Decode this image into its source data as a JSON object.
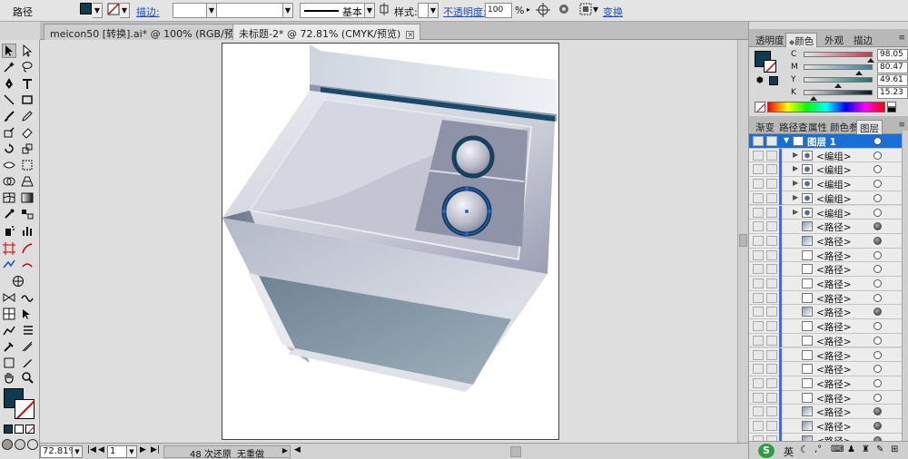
{
  "control_bar": {
    "mode_label": "路径",
    "stroke_label": "描边:",
    "stroke_style": "基本",
    "style_label": "样式:",
    "opacity_label": "不透明度:",
    "opacity_value": "100",
    "opacity_unit": "%",
    "transform_label": "变换",
    "fill_color": "#0e3a52"
  },
  "tabs": [
    {
      "label": "meicon50 [转换].ai* @ 100% (RGB/预览)",
      "active": false
    },
    {
      "label": "未标题-2* @ 72.81% (CMYK/预览)",
      "active": true
    }
  ],
  "tab_close_glyph": "×",
  "status_bar": {
    "zoom": "72.81%",
    "artboard": "1",
    "undo_text": "48 次还原",
    "redo_text": "无重做"
  },
  "color_panel": {
    "tabs": [
      "透明度",
      "颜色",
      "外观",
      "描边"
    ],
    "active_tab": "颜色",
    "channels": [
      {
        "label": "C",
        "value": "98.05",
        "pct": 0.98,
        "grad": "#e3e3e3,#c0394c"
      },
      {
        "label": "M",
        "value": "80.47",
        "pct": 0.8,
        "grad": "#e3e3e3,#3b7fa0"
      },
      {
        "label": "Y",
        "value": "49.61",
        "pct": 0.5,
        "grad": "#e3e3e3,#1c6f72"
      },
      {
        "label": "K",
        "value": "15.23",
        "pct": 0.15,
        "grad": "#e3e3e3,#071a26"
      }
    ],
    "unit": "%",
    "swatch_color": "#0e3a52"
  },
  "layers_panel": {
    "tabs": [
      "渐变",
      "路径查",
      "属性",
      "颜色参",
      "图层"
    ],
    "active_tab": "图层",
    "layer_name": "图层 1",
    "rows": [
      {
        "name": "<编组>",
        "kind": "group",
        "target": "empty"
      },
      {
        "name": "<编组>",
        "kind": "group",
        "target": "empty"
      },
      {
        "name": "<编组>",
        "kind": "group",
        "target": "empty"
      },
      {
        "name": "<编组>",
        "kind": "group",
        "target": "empty"
      },
      {
        "name": "<编组>",
        "kind": "group",
        "target": "empty"
      },
      {
        "name": "<路径>",
        "kind": "path",
        "target": "filled"
      },
      {
        "name": "<路径>",
        "kind": "path",
        "target": "filled"
      },
      {
        "name": "<路径>",
        "kind": "path",
        "target": "empty"
      },
      {
        "name": "<路径>",
        "kind": "path",
        "target": "empty"
      },
      {
        "name": "<路径>",
        "kind": "path",
        "target": "empty"
      },
      {
        "name": "<路径>",
        "kind": "path",
        "target": "empty"
      },
      {
        "name": "<路径>",
        "kind": "path",
        "target": "filled"
      },
      {
        "name": "<路径>",
        "kind": "path",
        "target": "empty"
      },
      {
        "name": "<路径>",
        "kind": "path",
        "target": "empty"
      },
      {
        "name": "<路径>",
        "kind": "path",
        "target": "empty"
      },
      {
        "name": "<路径>",
        "kind": "path",
        "target": "empty"
      },
      {
        "name": "<路径>",
        "kind": "path",
        "target": "empty"
      },
      {
        "name": "<路径>",
        "kind": "path",
        "target": "empty"
      },
      {
        "name": "<路径>",
        "kind": "path",
        "target": "filled"
      },
      {
        "name": "<路径>",
        "kind": "path",
        "target": "filled"
      },
      {
        "name": "<路径>",
        "kind": "path",
        "target": "filled"
      }
    ]
  },
  "bottom_right": {
    "ime_label": "英"
  }
}
